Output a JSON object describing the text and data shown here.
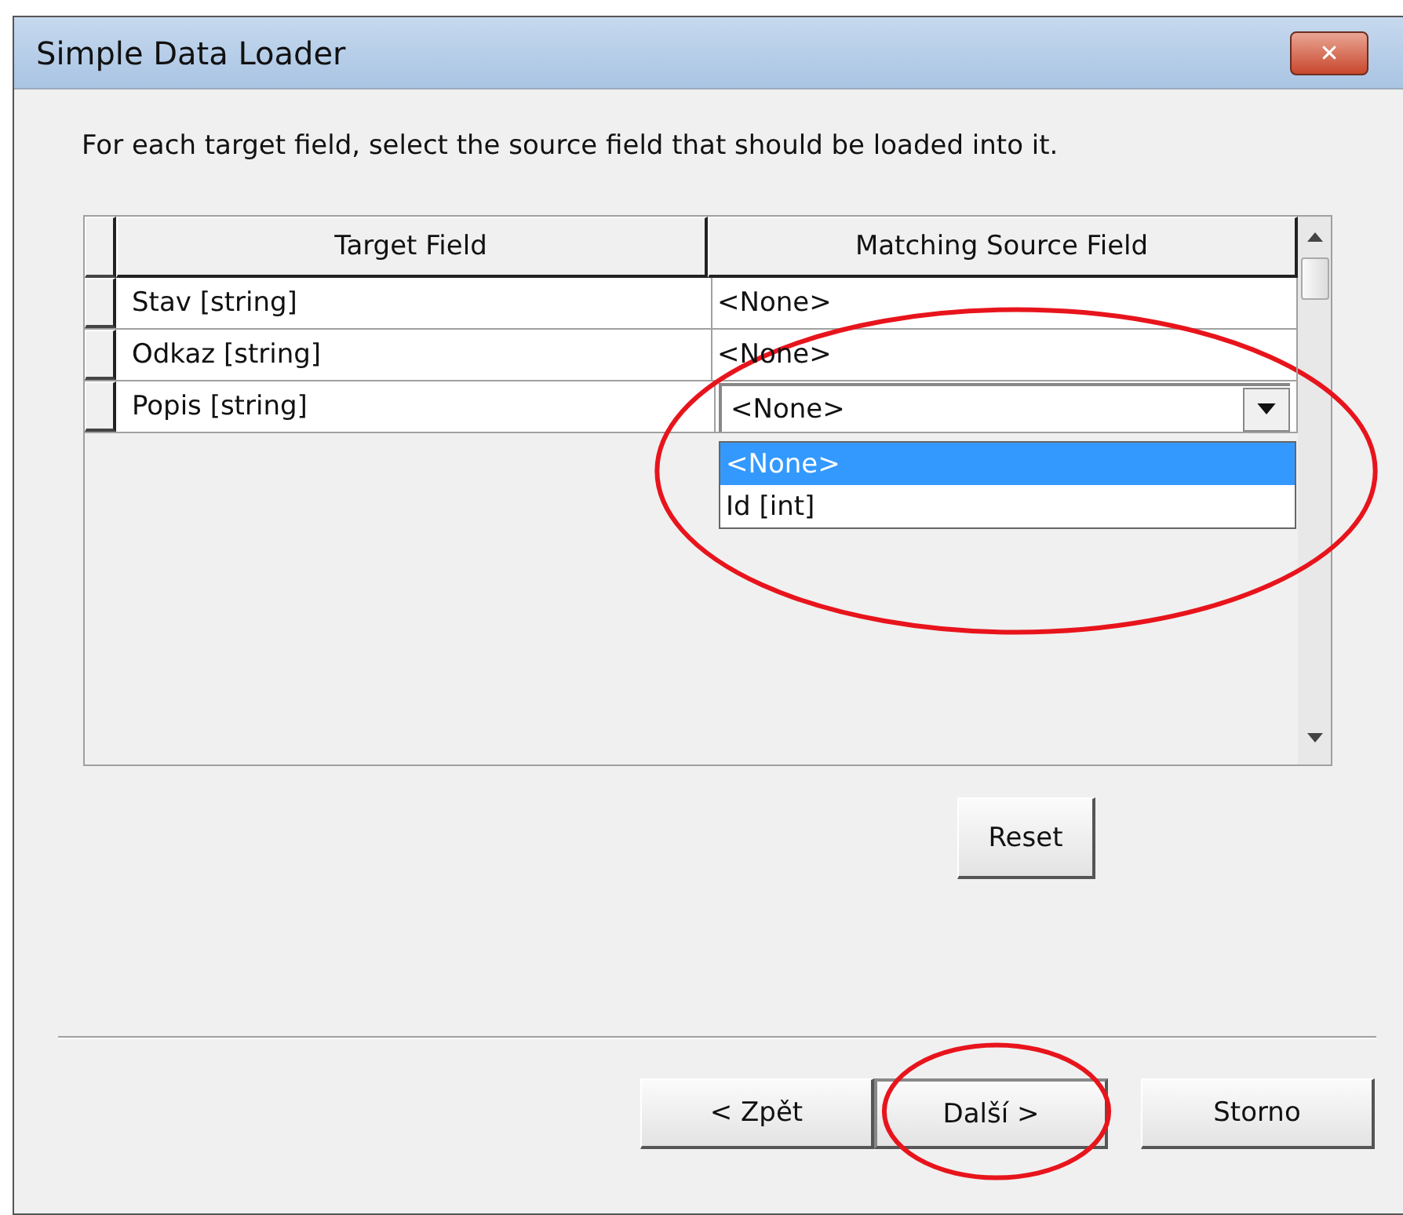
{
  "window": {
    "title": "Simple Data Loader",
    "close": "✕"
  },
  "instruction": "For each target field, select the source field that should be loaded into it.",
  "table": {
    "columns": [
      "Target Field",
      "Matching Source Field"
    ],
    "rows": [
      {
        "target": "Stav [string]",
        "source": "<None>",
        "kind": "text"
      },
      {
        "target": "Odkaz [string]",
        "source": "<None>",
        "kind": "text"
      },
      {
        "target": "Popis [string]",
        "source": "<None>",
        "kind": "combo",
        "expanded": true,
        "circled": true,
        "options": [
          {
            "label": "<None>",
            "selected": true
          },
          {
            "label": "Id [int]",
            "selected": false
          }
        ]
      }
    ]
  },
  "reset_button": "Reset",
  "nav_buttons": [
    {
      "label": "< Zpět",
      "default": false,
      "circled": false
    },
    {
      "label": "Další >",
      "default": true,
      "circled": true
    },
    {
      "label": "Storno",
      "default": false,
      "circled": false
    }
  ]
}
